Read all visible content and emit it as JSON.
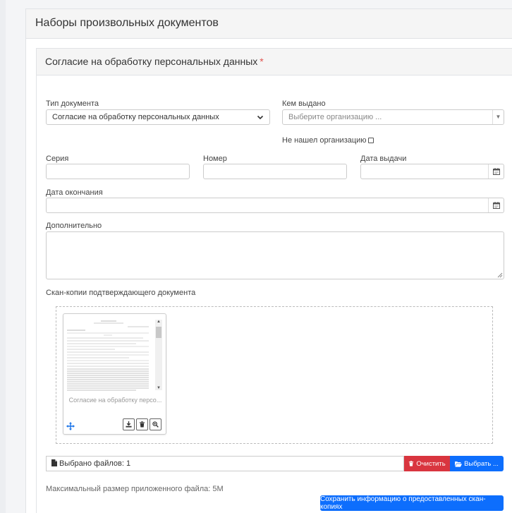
{
  "page": {
    "title": "Наборы произвольных документов"
  },
  "panel": {
    "title": "Согласие на обработку персональных данных",
    "required_mark": "*"
  },
  "form": {
    "doc_type_label": "Тип документа",
    "doc_type_value": "Согласие на обработку персональных данных",
    "issued_by_label": "Кем выдано",
    "issued_by_placeholder": "Выберите организацию ...",
    "not_found_org_label": "Не нашел организацию",
    "series_label": "Серия",
    "series_value": "",
    "number_label": "Номер",
    "number_value": "",
    "issue_date_label": "Дата выдачи",
    "issue_date_value": "",
    "end_date_label": "Дата окончания",
    "end_date_value": "",
    "additional_label": "Дополнительно",
    "additional_value": "",
    "scans_label": "Скан-копии подтверждающего документа"
  },
  "preview": {
    "file_caption": "Согласие на обработку персо...",
    "icons": [
      "download-icon",
      "trash-icon",
      "zoom-icon",
      "move-icon"
    ]
  },
  "file_input": {
    "selected_text": "Выбрано файлов: 1",
    "clear_label": "Очистить",
    "browse_label": "Выбрать ..."
  },
  "footer": {
    "max_size_text": "Максимальный размер приложенного файла: 5M",
    "save_label": "Сохранить информацию о предоставленных скан-копиях"
  },
  "colors": {
    "primary": "#0d6efd",
    "danger": "#d9353f",
    "required": "#e0534f"
  }
}
